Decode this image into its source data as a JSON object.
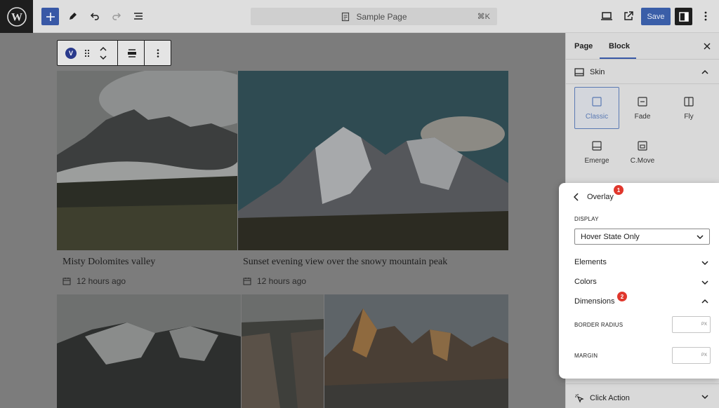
{
  "topbar": {
    "document_title": "Sample Page",
    "shortcut": "⌘K",
    "save_label": "Save"
  },
  "block_toolbar": {
    "block_badge": "V"
  },
  "posts": [
    {
      "caption": "Misty Dolomites valley",
      "date": "12 hours ago"
    },
    {
      "caption": "Sunset evening view over the snowy mountain peak",
      "date": "12 hours ago"
    }
  ],
  "sidebar": {
    "tabs": [
      "Page",
      "Block"
    ],
    "active_tab": "Block",
    "skin_title": "Skin",
    "skins": [
      "Classic",
      "Fade",
      "Fly",
      "Emerge",
      "C.Move"
    ],
    "active_skin": "Classic",
    "click_action_label": "Click Action"
  },
  "overlay_panel": {
    "title": "Overlay",
    "badge_1": "1",
    "display_label": "DISPLAY",
    "display_value": "Hover State Only",
    "sections": [
      "Elements",
      "Colors",
      "Dimensions"
    ],
    "badge_2": "2",
    "border_radius_label": "BORDER RADIUS",
    "margin_label": "MARGIN",
    "unit": "PX"
  },
  "colors": {
    "accent": "#3858a6",
    "badge": "#e0372c",
    "canvas_bg": "#7c7c7c"
  }
}
